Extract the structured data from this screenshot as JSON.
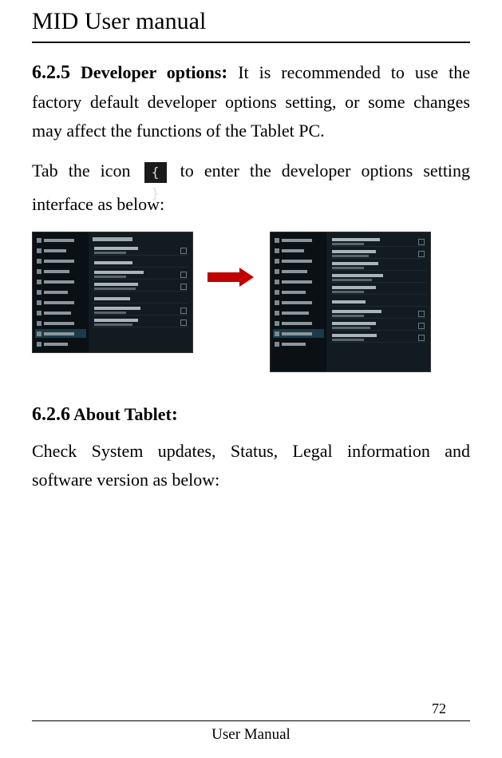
{
  "header": {
    "title": "MID User manual"
  },
  "sections": {
    "s625": {
      "number": "6.2.5",
      "heading": "Developer options",
      "colon": ":",
      "body_1a": "It is recommended to use the factory default developer options setting, or some changes may affect the functions of the Tablet PC.",
      "body_2_pre": "Tab the icon",
      "body_2_post": "to enter the developer options setting interface as below:",
      "icon_glyph": "{ }"
    },
    "s626": {
      "number": "6.2.6",
      "heading": "About Tablet",
      "colon": ":",
      "body": "Check System updates, Status, Legal information and software version as below:"
    }
  },
  "footer": {
    "page": "72",
    "label": "User Manual"
  }
}
